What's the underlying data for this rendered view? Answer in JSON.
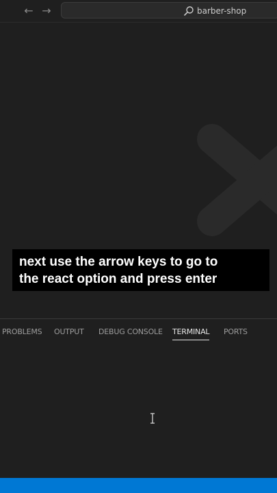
{
  "titlebar": {
    "back_icon": "arrow-left-icon",
    "forward_icon": "arrow-right-icon",
    "search_icon": "search-icon",
    "search_text": "barber-shop"
  },
  "caption": {
    "line1": "next use the arrow keys to go to",
    "line2": "the react option and press enter"
  },
  "panel": {
    "tabs": [
      {
        "label": "PROBLEMS",
        "active": false
      },
      {
        "label": "OUTPUT",
        "active": false
      },
      {
        "label": "DEBUG CONSOLE",
        "active": false
      },
      {
        "label": "TERMINAL",
        "active": true
      },
      {
        "label": "PORTS",
        "active": false
      }
    ]
  },
  "colors": {
    "background": "#1f1f1f",
    "statusbar": "#0078d4",
    "caption_bg": "#000000",
    "caption_text": "#ffffff",
    "active_tab": "#e7e7e7",
    "inactive_tab": "#9d9d9d"
  }
}
